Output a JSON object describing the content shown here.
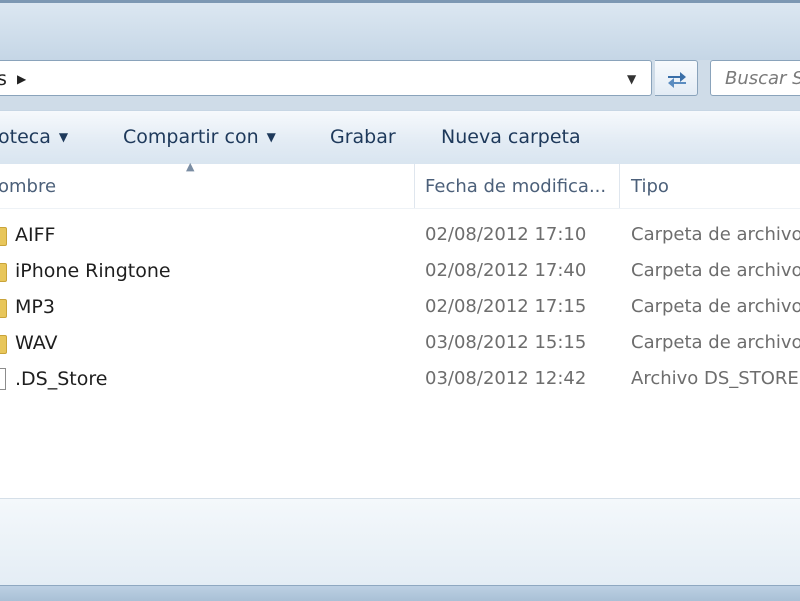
{
  "address": {
    "path_fragment": "s",
    "dropdown_glyph": "▼"
  },
  "search": {
    "placeholder": "Buscar S"
  },
  "toolbar": {
    "library_label": "oteca",
    "share_label": "Compartir con",
    "burn_label": "Grabar",
    "new_folder_label": "Nueva carpeta"
  },
  "columns": {
    "name": "ombre",
    "date": "Fecha de modifica...",
    "type": "Tipo"
  },
  "files": [
    {
      "name": "AIFF",
      "date": "02/08/2012 17:10",
      "type": "Carpeta de archivos",
      "icon": "folder-icon"
    },
    {
      "name": "iPhone Ringtone",
      "date": "02/08/2012 17:40",
      "type": "Carpeta de archivos",
      "icon": "folder-icon"
    },
    {
      "name": "MP3",
      "date": "02/08/2012 17:15",
      "type": "Carpeta de archivos",
      "icon": "folder-icon"
    },
    {
      "name": "WAV",
      "date": "03/08/2012 15:15",
      "type": "Carpeta de archivos",
      "icon": "folder-icon"
    },
    {
      "name": ".DS_Store",
      "date": "03/08/2012 12:42",
      "type": "Archivo DS_STORE",
      "icon": "file-icon"
    }
  ]
}
